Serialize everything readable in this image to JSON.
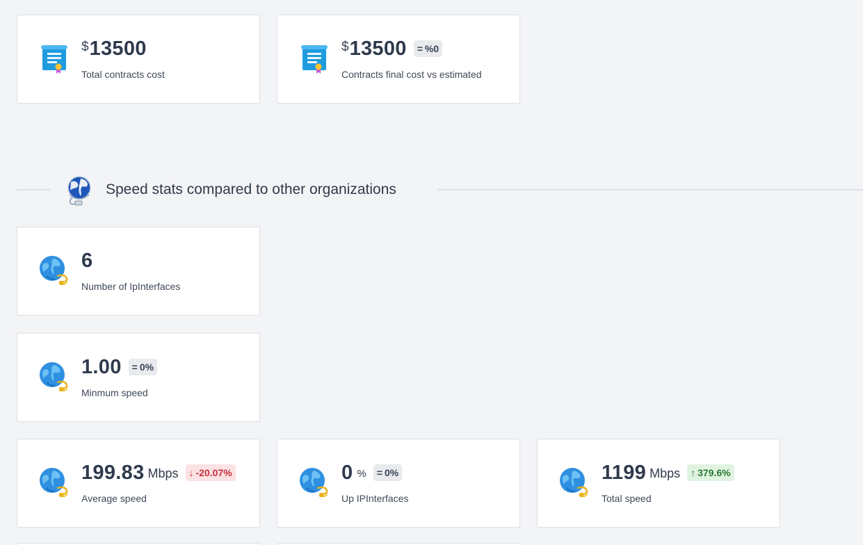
{
  "contracts": {
    "total_cost": {
      "currency": "$",
      "value": "13500",
      "label": "Total contracts cost",
      "icon": "contract-scroll-icon"
    },
    "final_vs_estimated": {
      "currency": "$",
      "value": "13500",
      "badge": {
        "symbol": "=",
        "text": "%0",
        "trend": "neutral"
      },
      "label": "Contracts final cost vs estimated",
      "icon": "contract-scroll-icon"
    }
  },
  "speed_section": {
    "title": "Speed stats compared to other organizations",
    "icon": "globe-network-icon"
  },
  "speed_stats": {
    "ip_interfaces": {
      "value": "6",
      "label": "Number of IpInterfaces",
      "icon": "globe-cable-icon"
    },
    "minimum_speed": {
      "value": "1.00",
      "badge": {
        "symbol": "=",
        "text": "0%",
        "trend": "neutral"
      },
      "label": "Minmum speed",
      "icon": "globe-cable-icon"
    },
    "average_speed": {
      "value": "199.83",
      "unit": "Mbps",
      "badge": {
        "symbol": "↓",
        "text": "-20.07%",
        "trend": "down"
      },
      "label": "Average speed",
      "icon": "globe-cable-icon"
    },
    "up_interfaces": {
      "value": "0",
      "unit": "%",
      "badge": {
        "symbol": "=",
        "text": "0%",
        "trend": "neutral"
      },
      "label": "Up IPInterfaces",
      "icon": "globe-cable-icon"
    },
    "total_speed": {
      "value": "1199",
      "unit": "Mbps",
      "badge": {
        "symbol": "↑",
        "text": "379.6%",
        "trend": "up"
      },
      "label": "Total speed",
      "icon": "globe-cable-icon"
    }
  },
  "colors": {
    "card_bg": "#ffffff",
    "page_bg": "#f3f4f6",
    "badge_down_bg": "#fbe2e4",
    "badge_down_text": "#c9303c",
    "badge_up_bg": "#dff3e0",
    "badge_up_text": "#2c7a34",
    "badge_neutral_bg": "#e8eaee"
  }
}
